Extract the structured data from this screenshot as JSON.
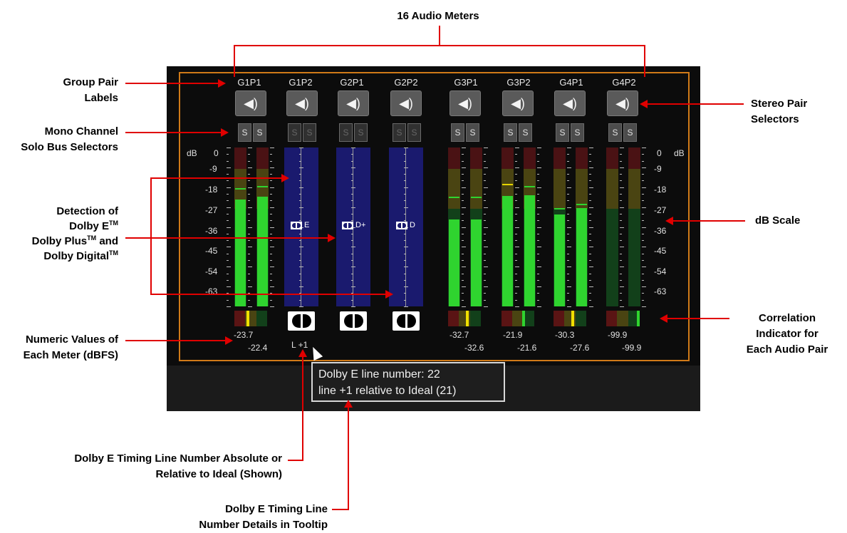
{
  "callouts": {
    "top": "16 Audio Meters",
    "group_labels": "Group Pair\nLabels",
    "mono_solo": "Mono Channel\nSolo Bus Selectors",
    "dolby_detect_1": "Detection of",
    "dolby_detect_2": "Dolby E",
    "dolby_detect_3": "Dolby Plus",
    "dolby_detect_3b": " and",
    "dolby_detect_4": "Dolby Digital",
    "tm": "TM",
    "numeric": "Numeric Values of\nEach Meter (dBFS)",
    "stereo_pair": "Stereo Pair\nSelectors",
    "db_scale": "dB Scale",
    "correlation": "Correlation\nIndicator for\nEach Audio Pair",
    "timing_line": "Dolby E Timing Line Number Absolute or\nRelative to Ideal (Shown)",
    "timing_tooltip": "Dolby E Timing Line\nNumber Details in Tooltip"
  },
  "groups": [
    "G1P1",
    "G1P2",
    "G2P1",
    "G2P2",
    "G3P1",
    "G3P2",
    "G4P1",
    "G4P2"
  ],
  "solo_label": "S",
  "speaker_icon": "speaker-icon",
  "db_unit": "dB",
  "db_scale": [
    "0",
    "-9",
    "-18",
    "-27",
    "-36",
    "-45",
    "-54",
    "-63"
  ],
  "dolby_tags": [
    "E",
    "D+",
    "D"
  ],
  "numeric_values": {
    "g1p1_a": "-23.7",
    "g1p1_b": "-22.4",
    "g3p1_a": "-32.7",
    "g3p1_b": "-32.6",
    "g3p2_a": "-21.9",
    "g3p2_b": "-21.6",
    "g4p1_a": "-30.3",
    "g4p1_b": "-27.6",
    "g4p2_a": "-99.9",
    "g4p2_b": "-99.9"
  },
  "timing_value": "L +1",
  "tooltip": {
    "line1": "Dolby E line number: 22",
    "line2": "line +1 relative to Ideal (21)"
  },
  "colors": {
    "accent": "#d07a18",
    "meter_green": "#2fd42f",
    "callout_red": "#e00000",
    "dolby_blue": "#1a1a6e"
  }
}
